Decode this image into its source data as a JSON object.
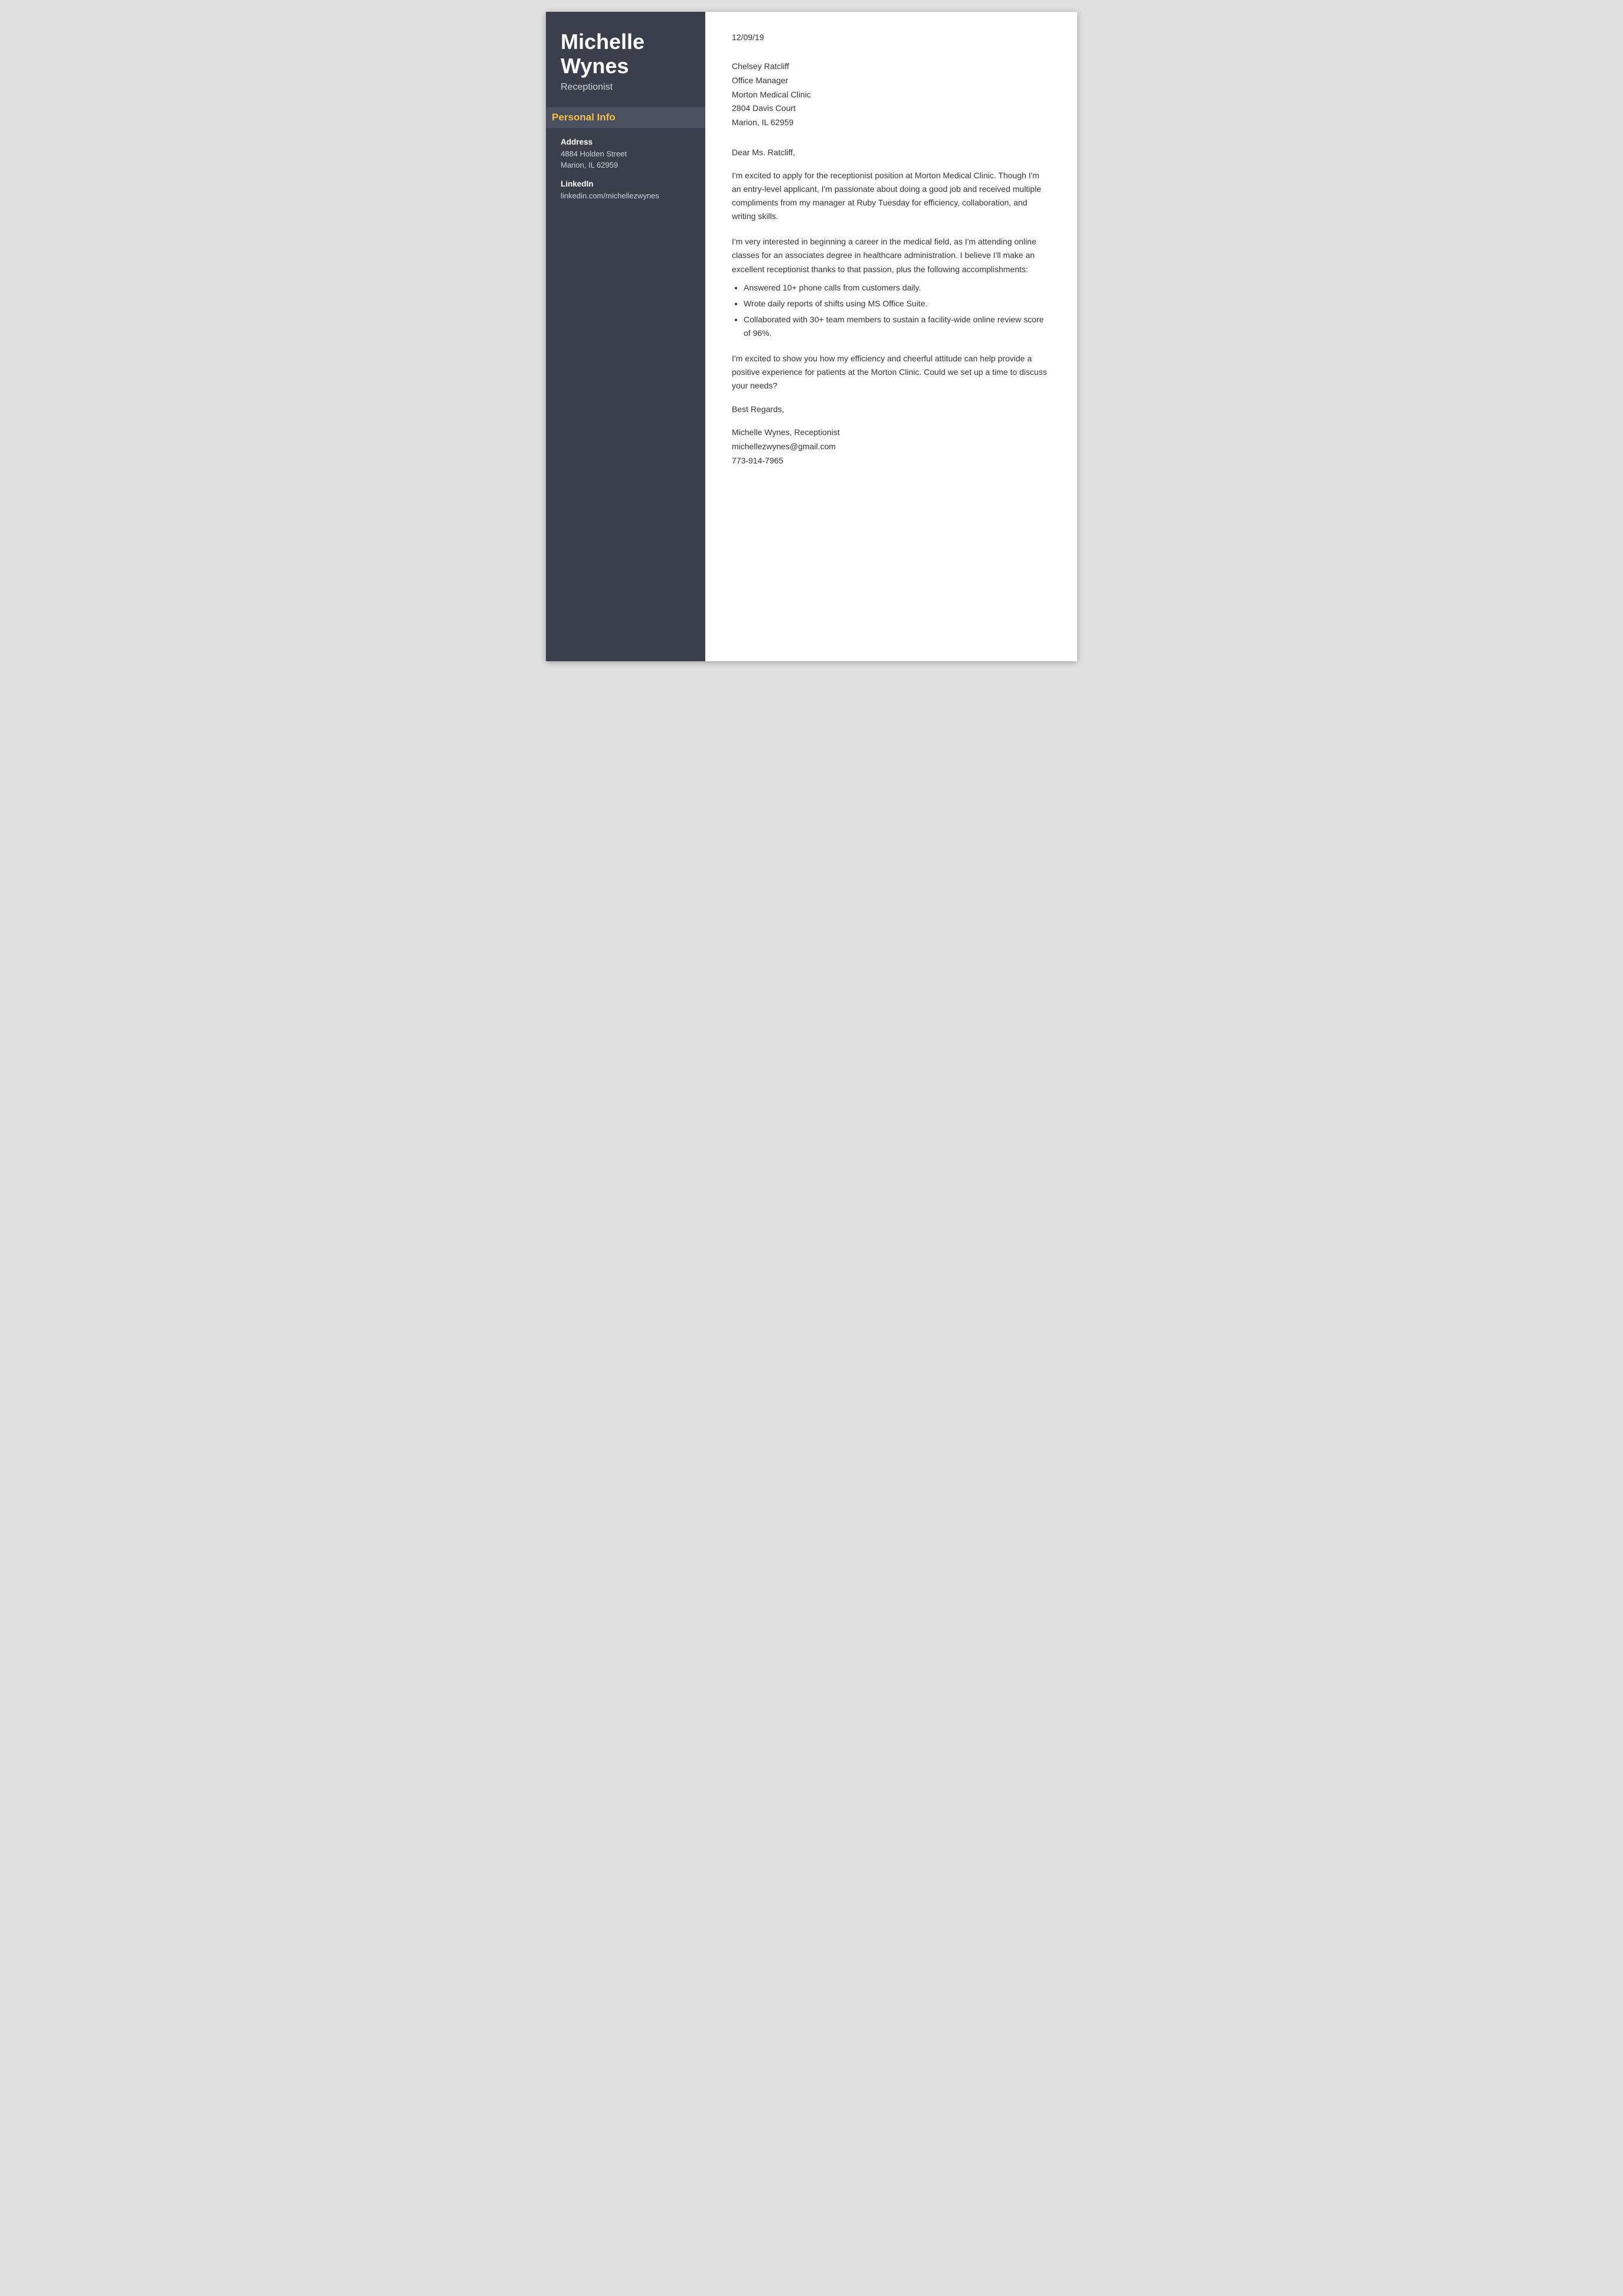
{
  "sidebar": {
    "name": "Michelle\nWynes",
    "name_line1": "Michelle",
    "name_line2": "Wynes",
    "title": "Receptionist",
    "personal_info_label": "Personal Info",
    "address_label": "Address",
    "address_line1": "4884 Holden Street",
    "address_line2": "Marion, IL 62959",
    "linkedin_label": "LinkedIn",
    "linkedin_value": "linkedin.com/michellezwynes"
  },
  "main": {
    "date": "12/09/19",
    "recipient": {
      "name": "Chelsey Ratcliff",
      "role": "Office Manager",
      "company": "Morton Medical Clinic",
      "address_line1": "2804 Davis Court",
      "address_line2": "Marion, IL 62959"
    },
    "salutation": "Dear Ms. Ratcliff,",
    "paragraph1": "I'm excited to apply for the receptionist position at Morton Medical Clinic. Though I'm an entry-level applicant, I'm passionate about doing a good job and received multiple compliments from my manager at Ruby Tuesday for efficiency, collaboration, and writing skills.",
    "paragraph2_intro": "I'm very interested in beginning a career in the medical field, as I'm attending online classes for an associates degree in healthcare administration. I believe I'll make an excellent receptionist thanks to that passion, plus the following accomplishments:",
    "bullets": [
      "Answered 10+ phone calls from customers daily.",
      "Wrote daily reports of shifts using MS Office Suite.",
      "Collaborated with 30+ team members to sustain a facility-wide online review score of 96%."
    ],
    "paragraph3": "I'm excited to show you how my efficiency and cheerful attitude can help provide a positive experience for patients at the Morton Clinic. Could we set up a time to discuss your needs?",
    "closing": "Best Regards,",
    "sig_name": "Michelle Wynes, Receptionist",
    "sig_email": "michellezwynes@gmail.com",
    "sig_phone": "773-914-7965"
  }
}
